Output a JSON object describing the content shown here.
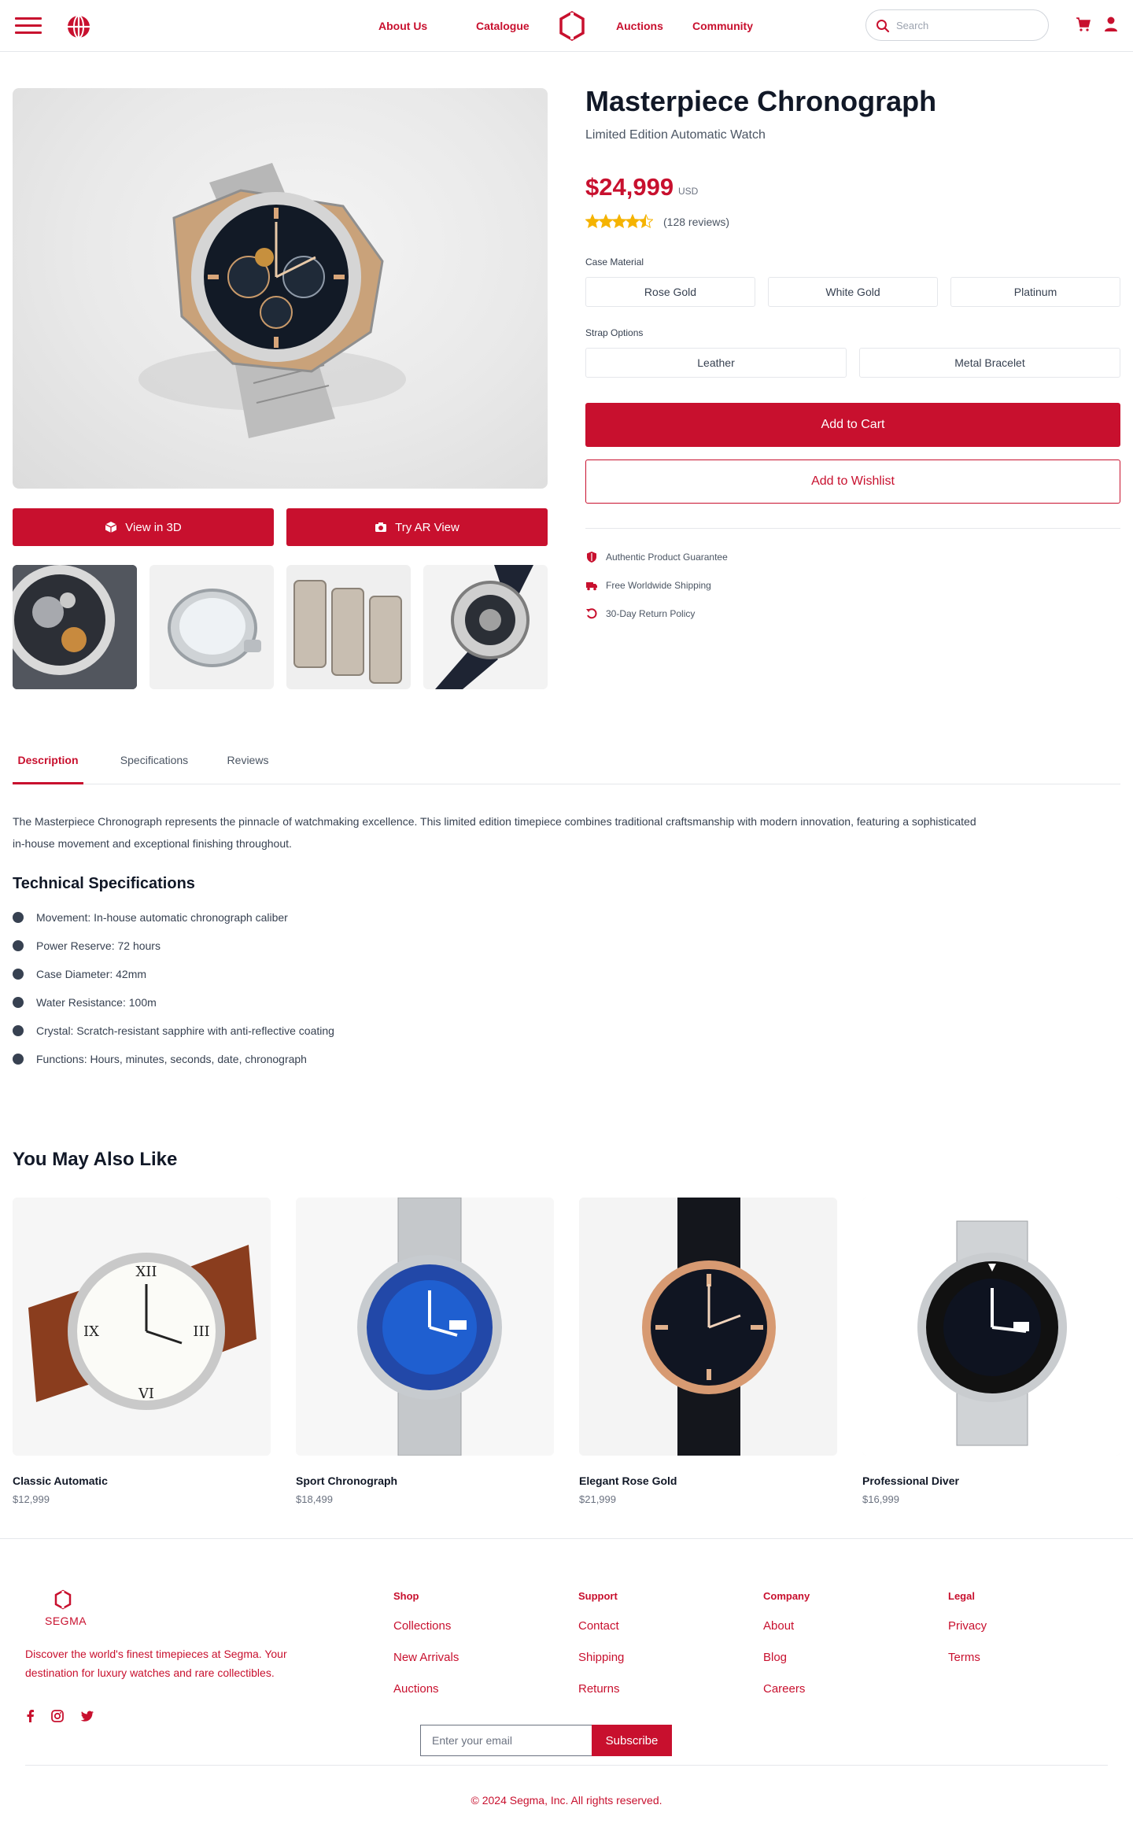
{
  "nav": {
    "links": [
      "About Us",
      "Catalogue",
      "Auctions",
      "Community"
    ],
    "search_placeholder": "Search"
  },
  "gallery": {
    "view3d_label": "View in 3D",
    "ar_label": "Try AR View"
  },
  "product": {
    "title": "Masterpiece Chronograph",
    "subtitle": "Limited Edition Automatic Watch",
    "price": "$24,999",
    "currency": "USD",
    "rating": 4.5,
    "reviews": "(128 reviews)",
    "case_label": "Case Material",
    "case_options": [
      "Rose Gold",
      "White Gold",
      "Platinum"
    ],
    "strap_label": "Strap Options",
    "strap_options": [
      "Leather",
      "Metal Bracelet"
    ],
    "add_to_cart": "Add to Cart",
    "add_to_wishlist": "Add to Wishlist",
    "features": [
      "Authentic Product Guarantee",
      "Free Worldwide Shipping",
      "30-Day Return Policy"
    ]
  },
  "tabs": [
    "Description",
    "Specifications",
    "Reviews"
  ],
  "description": "The Masterpiece Chronograph represents the pinnacle of watchmaking excellence. This limited edition timepiece combines traditional craftsmanship with modern innovation, featuring a sophisticated in-house movement and exceptional finishing throughout.",
  "tech": {
    "title": "Technical Specifications",
    "items": [
      "Movement: In-house automatic chronograph caliber",
      "Power Reserve: 72 hours",
      "Case Diameter: 42mm",
      "Water Resistance: 100m",
      "Crystal: Scratch-resistant sapphire with anti-reflective coating",
      "Functions: Hours, minutes, seconds, date, chronograph"
    ]
  },
  "related": {
    "title": "You May Also Like",
    "items": [
      {
        "name": "Classic Automatic",
        "price": "$12,999"
      },
      {
        "name": "Sport Chronograph",
        "price": "$18,499"
      },
      {
        "name": "Elegant Rose Gold",
        "price": "$21,999"
      },
      {
        "name": "Professional Diver",
        "price": "$16,999"
      }
    ]
  },
  "footer": {
    "brand": "SEGMA",
    "description": "Discover the world's finest timepieces at Segma. Your destination for luxury watches and rare collectibles.",
    "columns": [
      {
        "title": "Shop",
        "links": [
          "Collections",
          "New Arrivals",
          "Auctions"
        ]
      },
      {
        "title": "Support",
        "links": [
          "Contact",
          "Shipping",
          "Returns"
        ]
      },
      {
        "title": "Company",
        "links": [
          "About",
          "Blog",
          "Careers"
        ]
      },
      {
        "title": "Legal",
        "links": [
          "Privacy",
          "Terms"
        ]
      }
    ],
    "email_placeholder": "Enter your email",
    "subscribe": "Subscribe",
    "copyright": "© 2024 Segma, Inc. All rights reserved."
  },
  "colors": {
    "accent": "#c8102e",
    "star": "#f5b301"
  }
}
